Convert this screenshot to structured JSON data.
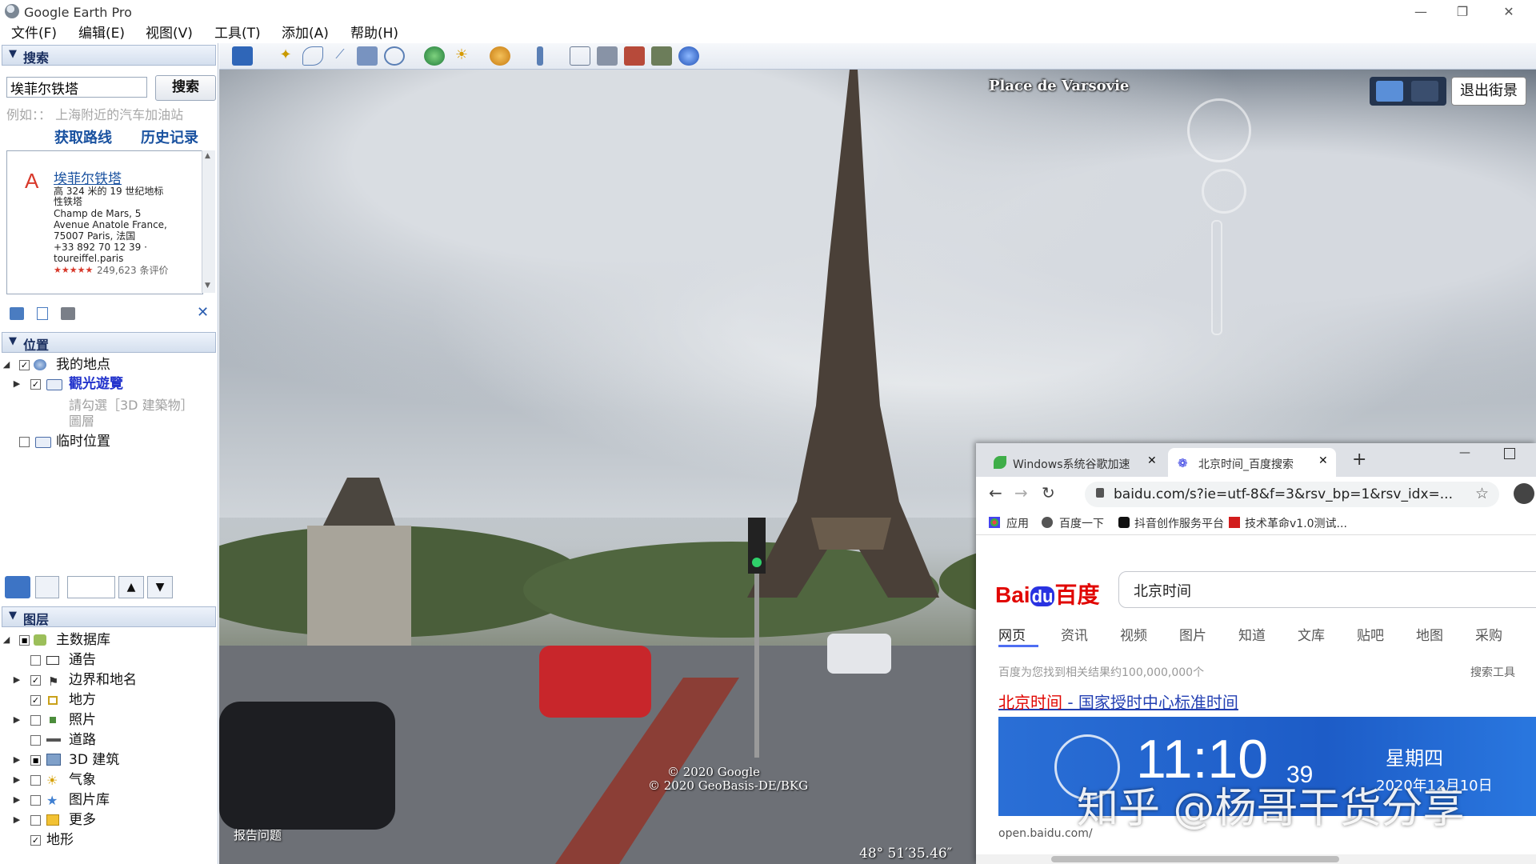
{
  "window": {
    "title": "Google Earth Pro",
    "controls": {
      "minimize": "—",
      "restore": "❐",
      "close": "✕"
    }
  },
  "menu": [
    "文件(F)",
    "编辑(E)",
    "视图(V)",
    "工具(T)",
    "添加(A)",
    "帮助(H)"
  ],
  "search_panel": {
    "header": "搜索",
    "query": "埃菲尔铁塔",
    "button": "搜索",
    "hint": "例如：：  上海附近的汽车加油站",
    "links": [
      "获取路线",
      "历史记录"
    ],
    "result": {
      "marker": "A",
      "title": "埃菲尔铁塔",
      "lines": [
        "高 324 米的 19 世纪地标",
        "性铁塔",
        "Champ de Mars, 5",
        "Avenue Anatole France,",
        "75007 Paris, 法国",
        "+33 892 70 12 39 ·",
        "toureiffel.paris"
      ],
      "rating_stars": "★★★★★",
      "rating_count": "249,623 条评价"
    }
  },
  "places_panel": {
    "header": "位置",
    "items": [
      {
        "label": "我的地点",
        "checked": "✓"
      },
      {
        "label": "觀光遊覽",
        "checked": "✓"
      },
      {
        "label": "請勾選［3D 建築物］",
        "note": true
      },
      {
        "label": "圖層",
        "note": true
      },
      {
        "label": "临时位置",
        "checked": ""
      }
    ]
  },
  "layers_panel": {
    "header": "图层",
    "items": [
      {
        "label": "主数据库",
        "checked": "■"
      },
      {
        "label": "通告",
        "checked": ""
      },
      {
        "label": "边界和地名",
        "checked": "✓"
      },
      {
        "label": "地方",
        "checked": "✓"
      },
      {
        "label": "照片",
        "checked": ""
      },
      {
        "label": "道路",
        "checked": ""
      },
      {
        "label": "3D 建筑",
        "checked": "■"
      },
      {
        "label": "气象",
        "checked": ""
      },
      {
        "label": "图片库",
        "checked": ""
      },
      {
        "label": "更多",
        "checked": ""
      },
      {
        "label": "地形",
        "checked": "✓"
      }
    ]
  },
  "streetview": {
    "place_name": "Place de Varsovie",
    "exit_button": "退出街景",
    "copyright": [
      "© 2020 Google",
      "© 2020 GeoBasis-DE/BKG"
    ],
    "report": "报告问题",
    "coordinate": "48° 51′35.46″"
  },
  "browser": {
    "tabs": [
      {
        "label": "Windows系统谷歌加速"
      },
      {
        "label": "北京时间_百度搜索"
      }
    ],
    "new_tab": "+",
    "url": "baidu.com/s?ie=utf-8&f=3&rsv_bp=1&rsv_idx=...",
    "bookmarks": [
      "应用",
      "百度一下",
      "抖音创作服务平台",
      "技术革命v1.0测试..."
    ],
    "baidu": {
      "logo_bai": "Bai",
      "logo_du": "du",
      "logo_cn": "百度",
      "query": "北京时间",
      "nav": [
        "网页",
        "资讯",
        "视频",
        "图片",
        "知道",
        "文库",
        "贴吧",
        "地图",
        "采购"
      ],
      "result_count": "百度为您找到相关结果约100,000,000个",
      "search_tools": "搜索工具",
      "result_title_em": "北京时间",
      "result_title_rest": " - 国家授时中心标准时间",
      "clock": {
        "time": "11:10",
        "seconds": "39",
        "weekday": "星期四",
        "date": "2020年12月10日"
      },
      "result_url": "open.baidu.com/"
    }
  },
  "watermark": "知乎 @杨哥干货分享",
  "colors": {
    "accent": "#1a52a0",
    "baidu_red": "#e10602",
    "baidu_blue": "#2932e1",
    "panel_header": "#d4dfee"
  }
}
